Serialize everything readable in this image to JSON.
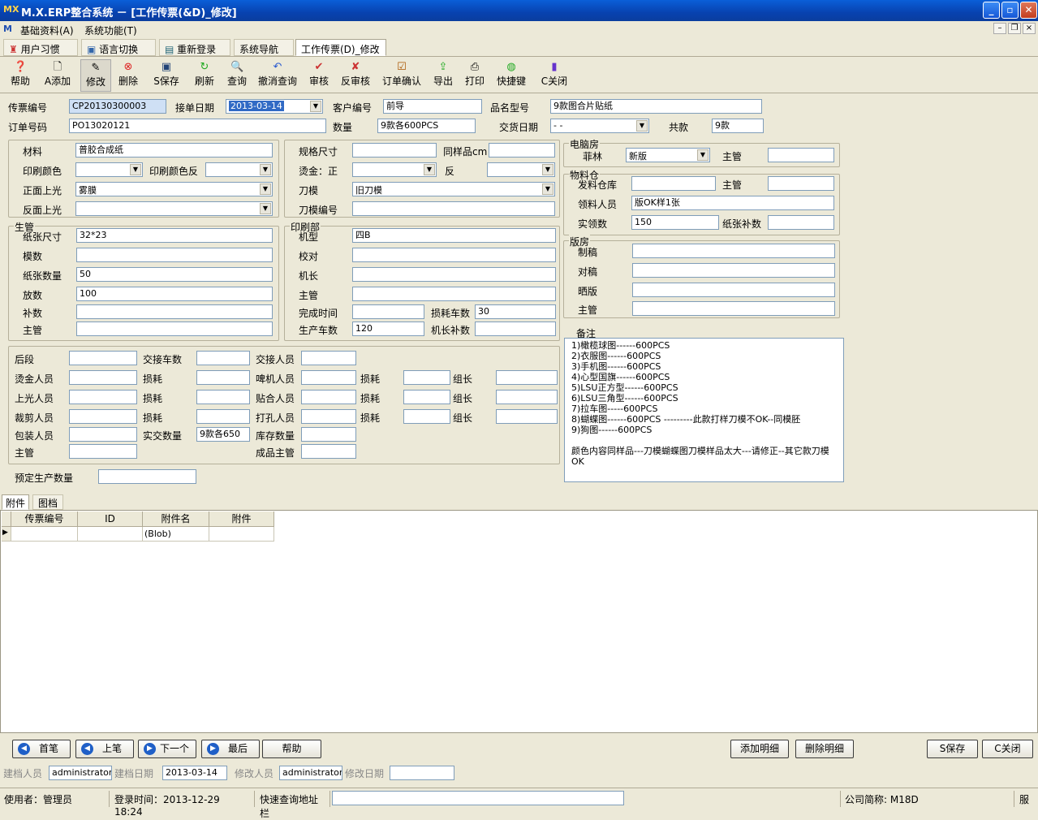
{
  "window": {
    "title": "M.X.ERP整合系统 － [工作传票(&D)_修改]",
    "logo": "MX"
  },
  "menu": {
    "items": [
      "基础资料(A)",
      "系统功能(T)"
    ]
  },
  "tabs": [
    "用户习惯",
    "语言切换",
    "重新登录",
    "系统导航",
    "工作传票(D)_修改"
  ],
  "toolbar": [
    "帮助",
    "A添加",
    "修改",
    "删除",
    "S保存",
    "刷新",
    "查询",
    "撤消查询",
    "审核",
    "反审核",
    "订单确认",
    "导出",
    "打印",
    "快捷键",
    "C关闭"
  ],
  "header": {
    "ticket_no_label": "传票编号",
    "ticket_no": "CP20130300003",
    "order_date_label": "接单日期",
    "order_date": "2013-03-14",
    "customer_label": "客户编号",
    "customer": "前导",
    "product_label": "品名型号",
    "product": "9款图合片贴纸",
    "order_no_label": "订单号码",
    "order_no": "PO13020121",
    "qty_label": "数量",
    "qty": "9款各600PCS",
    "delivery_label": "交货日期",
    "delivery": "  -  -",
    "total_label": "共款",
    "total": "9款"
  },
  "materials": {
    "material_label": "材料",
    "material": "普胶合成纸",
    "print_color_label": "印刷颜色",
    "print_color": "",
    "print_color_rev_label": "印刷颜色反",
    "print_color_rev": "",
    "front_gloss_label": "正面上光",
    "front_gloss": "雾膜",
    "back_gloss_label": "反面上光",
    "back_gloss": ""
  },
  "spec": {
    "size_label": "规格尺寸",
    "size": "",
    "sample_label": "同样品cm",
    "sample": "",
    "foil_label": "烫金：正",
    "foil_front": "",
    "foil_back_label": "反",
    "foil_back": "",
    "die_label": "刀模",
    "die": "旧刀模",
    "die_no_label": "刀模编号",
    "die_no": ""
  },
  "computer_room": {
    "title": "电脑房",
    "film_label": "菲林",
    "film": "新版",
    "supervisor_label": "主管",
    "supervisor": ""
  },
  "warehouse": {
    "title": "物料仓",
    "issue_label": "发料仓库",
    "issue": "",
    "supervisor_label": "主管",
    "supervisor": "",
    "receiver_label": "领料人员",
    "receiver": "版OK样1张",
    "actual_label": "实领数",
    "actual": "150",
    "extra_label": "纸张补数",
    "extra": ""
  },
  "plate_room": {
    "title": "版房",
    "items": [
      {
        "label": "制稿",
        "value": ""
      },
      {
        "label": "对稿",
        "value": ""
      },
      {
        "label": "晒版",
        "value": ""
      },
      {
        "label": "主管",
        "value": ""
      }
    ]
  },
  "production": {
    "title": "生管",
    "rows": [
      {
        "label": "纸张尺寸",
        "value": "32*23"
      },
      {
        "label": "模数",
        "value": ""
      },
      {
        "label": "纸张数量",
        "value": "50"
      },
      {
        "label": "放数",
        "value": "100"
      },
      {
        "label": "补数",
        "value": ""
      },
      {
        "label": "主管",
        "value": ""
      }
    ]
  },
  "printing": {
    "title": "印刷部",
    "machine_label": "机型",
    "machine": "四B",
    "proof_label": "校对",
    "proof": "",
    "captain_label": "机长",
    "captain": "",
    "supervisor_label": "主管",
    "supervisor": "",
    "finish_label": "完成时间",
    "finish": "",
    "loss_label": "损耗车数",
    "loss": "30",
    "prod_label": "生产车数",
    "prod": "120",
    "captain_extra_label": "机长补数",
    "captain_extra": ""
  },
  "post": {
    "r1": [
      "后段",
      "",
      "交接车数",
      "",
      "交接人员",
      ""
    ],
    "r2": [
      "烫金人员",
      "",
      "损耗",
      "",
      "啤机人员",
      "",
      "损耗",
      "",
      "组长",
      ""
    ],
    "r3": [
      "上光人员",
      "",
      "损耗",
      "",
      "贴合人员",
      "",
      "损耗",
      "",
      "组长",
      ""
    ],
    "r4": [
      "裁剪人员",
      "",
      "损耗",
      "",
      "打孔人员",
      "",
      "损耗",
      "",
      "组长",
      ""
    ],
    "r5": [
      "包装人员",
      "",
      "实交数量",
      "9款各650",
      "库存数量",
      ""
    ],
    "r6": [
      "主管",
      "",
      "成品主管",
      ""
    ],
    "planned_label": "预定生产数量",
    "planned": ""
  },
  "notes": {
    "title": "备注",
    "lines": [
      "1)橄榄球图------600PCS",
      "2)衣服图------600PCS",
      "3)手机图------600PCS",
      "4)心型国旗------600PCS",
      "5)LSU正方型------600PCS",
      "6)LSU三角型------600PCS",
      "7)拉车图-----600PCS",
      "8)蝴蝶图------600PCS ---------此款打样刀模不OK--同模胚",
      "9)狗图------600PCS",
      "",
      "颜色内容同样品---刀模蝴蝶图刀模样品太大---请修正--其它款刀模OK"
    ]
  },
  "bottom_tabs": [
    "附件",
    "图档"
  ],
  "grid": {
    "headers": [
      "传票编号",
      "ID",
      "附件名",
      "附件"
    ],
    "row": [
      "",
      "",
      "(Blob)",
      ""
    ]
  },
  "nav": {
    "first": "首笔",
    "prev": "上笔",
    "next": "下一个",
    "last": "最后",
    "help": "帮助",
    "add_detail": "添加明细",
    "del_detail": "删除明细",
    "save": "S保存",
    "close": "C关闭"
  },
  "audit": {
    "creator_label": "建档人员",
    "creator": "administrator",
    "create_date_label": "建档日期",
    "create_date": "2013-03-14",
    "modifier_label": "修改人员",
    "modifier": "administrator",
    "modify_date_label": "修改日期",
    "modify_date": ""
  },
  "status": {
    "user": "使用者：管理员",
    "login": "登录时间：2013-12-29 18:24",
    "quick_label": "快速查询地址栏",
    "company": "公司简称: M18D",
    "service": "服务"
  }
}
